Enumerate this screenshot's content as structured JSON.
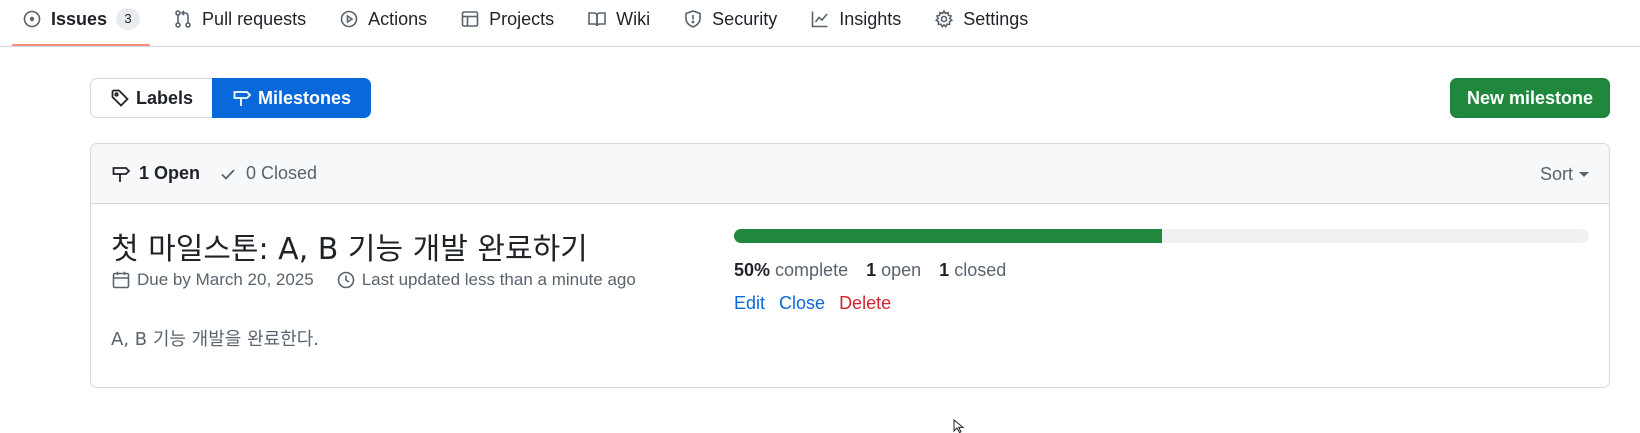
{
  "repo_nav": {
    "tabs": [
      {
        "label": "Issues",
        "icon": "issue-opened-icon",
        "counter": "3",
        "selected": true
      },
      {
        "label": "Pull requests",
        "icon": "git-pull-request-icon"
      },
      {
        "label": "Actions",
        "icon": "play-icon"
      },
      {
        "label": "Projects",
        "icon": "table-icon"
      },
      {
        "label": "Wiki",
        "icon": "book-icon"
      },
      {
        "label": "Security",
        "icon": "shield-icon"
      },
      {
        "label": "Insights",
        "icon": "graph-icon"
      },
      {
        "label": "Settings",
        "icon": "gear-icon"
      }
    ]
  },
  "subnav": {
    "labels": "Labels",
    "milestones": "Milestones"
  },
  "new_milestone_button": "New milestone",
  "states": {
    "open_label": "1 Open",
    "closed_label": "0 Closed"
  },
  "sort_label": "Sort",
  "milestone": {
    "title": "첫 마일스톤: A, B 기능 개발 완료하기",
    "due": "Due by March 20, 2025",
    "updated": "Last updated less than a minute ago",
    "description": "A, B 기능 개발을 완료한다.",
    "progress_percent": 50,
    "percent_label": "50%",
    "complete_label": "complete",
    "open_count": "1",
    "open_label": "open",
    "closed_count": "1",
    "closed_label": "closed",
    "actions": {
      "edit": "Edit",
      "close": "Close",
      "delete": "Delete"
    }
  },
  "colors": {
    "accent": "#0969da",
    "success": "#1f883d",
    "danger": "#d1242f",
    "selected_underline": "#fd8c73"
  }
}
